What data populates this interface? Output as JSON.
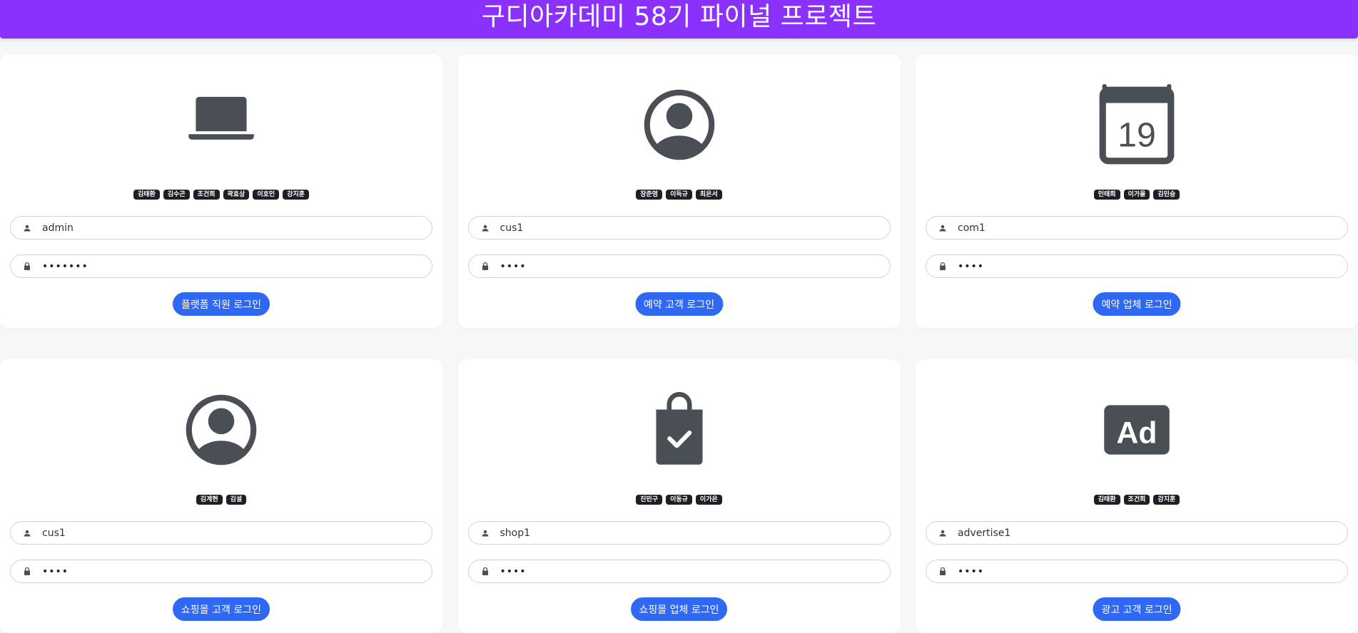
{
  "header": {
    "title": "구디아카데미 58기 파이널 프로젝트"
  },
  "colors": {
    "header_bg": "#8b31ff",
    "button_bg": "#2f68f2",
    "icon": "#4a4f56",
    "chip_bg": "#1c1f23"
  },
  "cards": [
    {
      "icon": "laptop-icon",
      "members": [
        "김태환",
        "김수곤",
        "조건희",
        "곽효상",
        "이호인",
        "강지훈"
      ],
      "username": "admin",
      "password": "•••••••",
      "button_label": "플랫폼 직원 로그인"
    },
    {
      "icon": "account-circle-icon",
      "members": [
        "장준영",
        "이득규",
        "최은서"
      ],
      "username": "cus1",
      "password": "••••",
      "button_label": "예약 고객 로그인"
    },
    {
      "icon": "calendar-icon",
      "icon_text": "19",
      "members": [
        "인태희",
        "이가을",
        "김민승"
      ],
      "username": "com1",
      "password": "••••",
      "button_label": "예약 업체 로그인"
    },
    {
      "icon": "account-circle-icon",
      "members": [
        "김계현",
        "김설"
      ],
      "username": "cus1",
      "password": "••••",
      "button_label": "쇼핑몰 고객 로그인"
    },
    {
      "icon": "shopping-bag-check-icon",
      "members": [
        "진민구",
        "이동규",
        "이가은"
      ],
      "username": "shop1",
      "password": "••••",
      "button_label": "쇼핑몰 업체 로그인"
    },
    {
      "icon": "ad-icon",
      "icon_text": "Ad",
      "members": [
        "김태환",
        "조건희",
        "강지훈"
      ],
      "username": "advertise1",
      "password": "••••",
      "button_label": "광고 고객 로그인"
    }
  ]
}
